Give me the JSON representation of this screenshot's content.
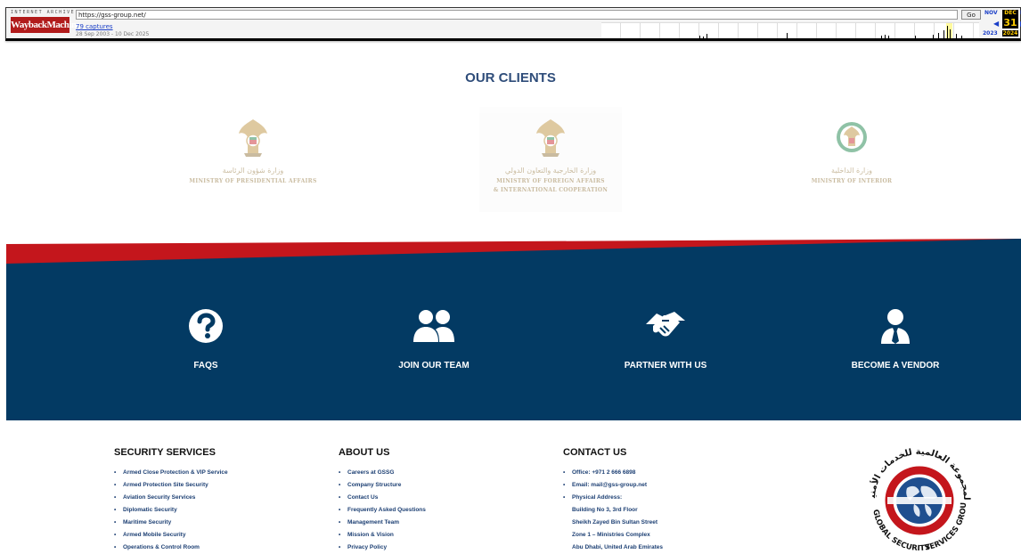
{
  "toolbar": {
    "ia_text": "INTERNET ARCHIVE",
    "logo_text": "WaybackMachine",
    "url": "https://gss-group.net/",
    "go_label": "Go",
    "captures": "79 captures",
    "range": "28 Sep 2003 - 10 Dec 2025",
    "cal_prev": "NOV",
    "cal_current": "DEC",
    "cal_next": "F",
    "cal_day": "31",
    "cal_year_prev": "2023",
    "cal_year_current": "2024"
  },
  "clients": {
    "title": "OUR CLIENTS",
    "items": [
      {
        "arabic": "وزارة شؤون الرئاسة",
        "english_1": "MINISTRY OF PRESIDENTIAL AFFAIRS",
        "english_2": ""
      },
      {
        "arabic": "وزارة الخارجية والتعاون الدولي",
        "english_1": "MINISTRY OF FOREIGN AFFAIRS",
        "english_2": "& INTERNATIONAL COOPERATION"
      },
      {
        "arabic": "وزارة الداخلية",
        "english_1": "MINISTRY OF INTERIOR",
        "english_2": ""
      }
    ]
  },
  "actions": [
    {
      "label": "FAQS",
      "icon": "question-circle-icon"
    },
    {
      "label": "JOIN OUR TEAM",
      "icon": "users-icon"
    },
    {
      "label": "PARTNER WITH US",
      "icon": "handshake-icon"
    },
    {
      "label": "BECOME A VENDOR",
      "icon": "user-tie-icon"
    }
  ],
  "footer": {
    "services": {
      "title": "SECURITY SERVICES",
      "items": [
        "Armed Close Protection & VIP Service",
        "Armed Protection Site Security",
        "Aviation Security Services",
        "Diplomatic Security",
        "Maritime Security",
        "Armed Mobile Security",
        "Operations & Control Room"
      ]
    },
    "about": {
      "title": "ABOUT US",
      "items": [
        "Careers at GSSG",
        "Company Structure",
        "Contact Us",
        "Frequently Asked Questions",
        "Management Team",
        "Mission & Vision",
        "Privacy Policy"
      ]
    },
    "contact": {
      "title": "CONTACT US",
      "office": "Office: +971 2 666 6898",
      "email": "Email: mail@gss-group.net",
      "address_label": "Physical Address:",
      "address": [
        "Building No 3, 3rd Floor",
        "Sheikh Zayed Bin Sultan Street",
        "Zone 1 – Ministries Complex",
        "Abu Dhabi, United Arab Emirates"
      ]
    },
    "logo": {
      "arabic": "المجموعة العالمية للخدمات الأمنية",
      "english_left": "GLOBAL SECURITY",
      "english_right": "SERVICES GROUP"
    }
  },
  "colors": {
    "navy": "#033a63",
    "red": "#c4161c",
    "title_blue": "#2f4d7a",
    "link_blue": "#1c3f73"
  }
}
